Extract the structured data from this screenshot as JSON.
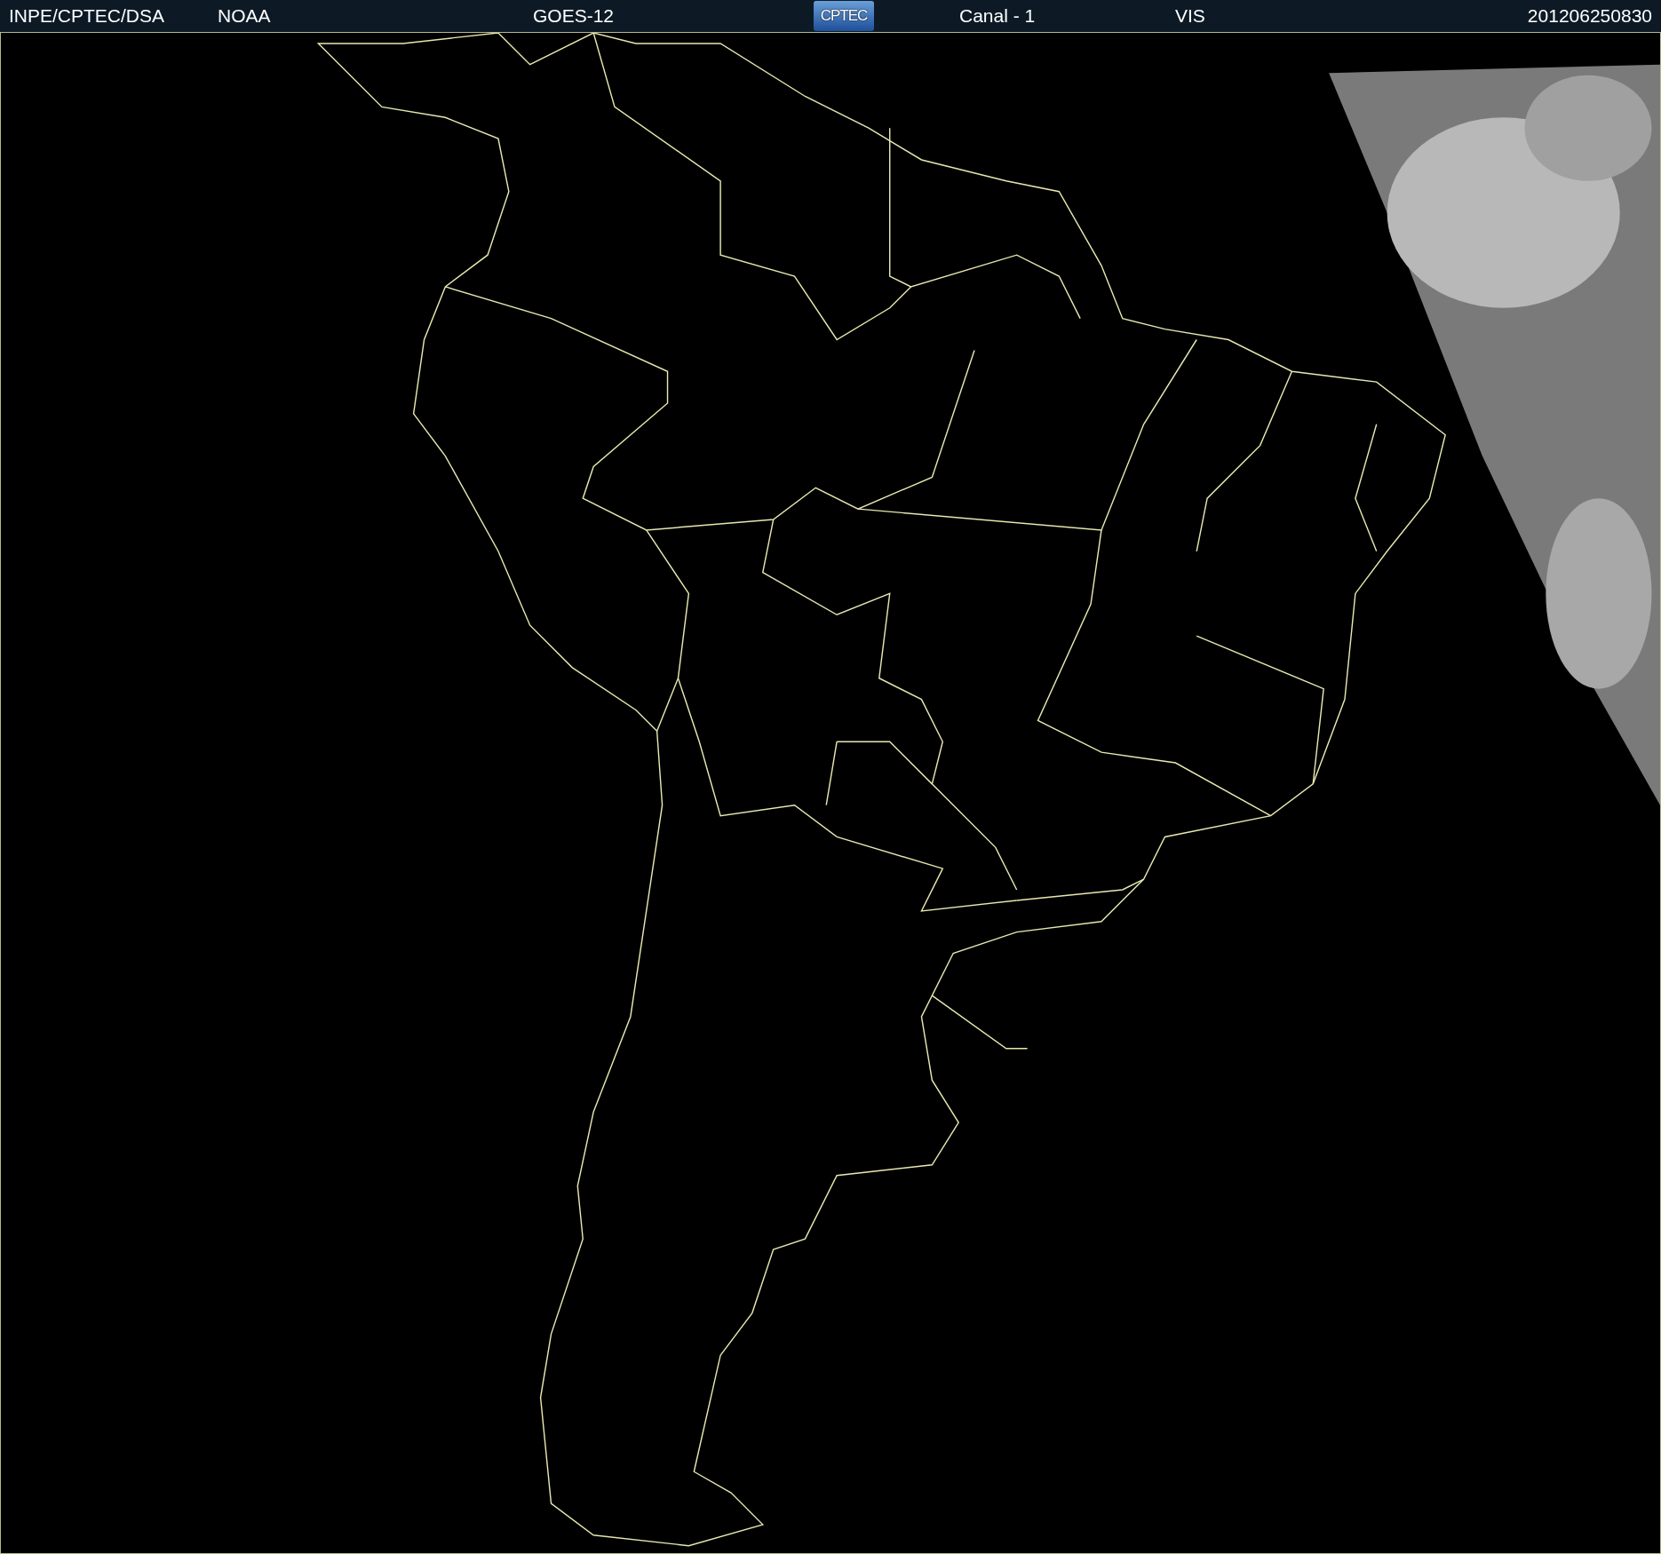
{
  "header": {
    "source": "INPE/CPTEC/DSA",
    "agency": "NOAA",
    "satellite": "GOES-12",
    "logo": "CPTEC",
    "channel": "Canal - 1",
    "band": "VIS",
    "timestamp": "201206250830"
  }
}
